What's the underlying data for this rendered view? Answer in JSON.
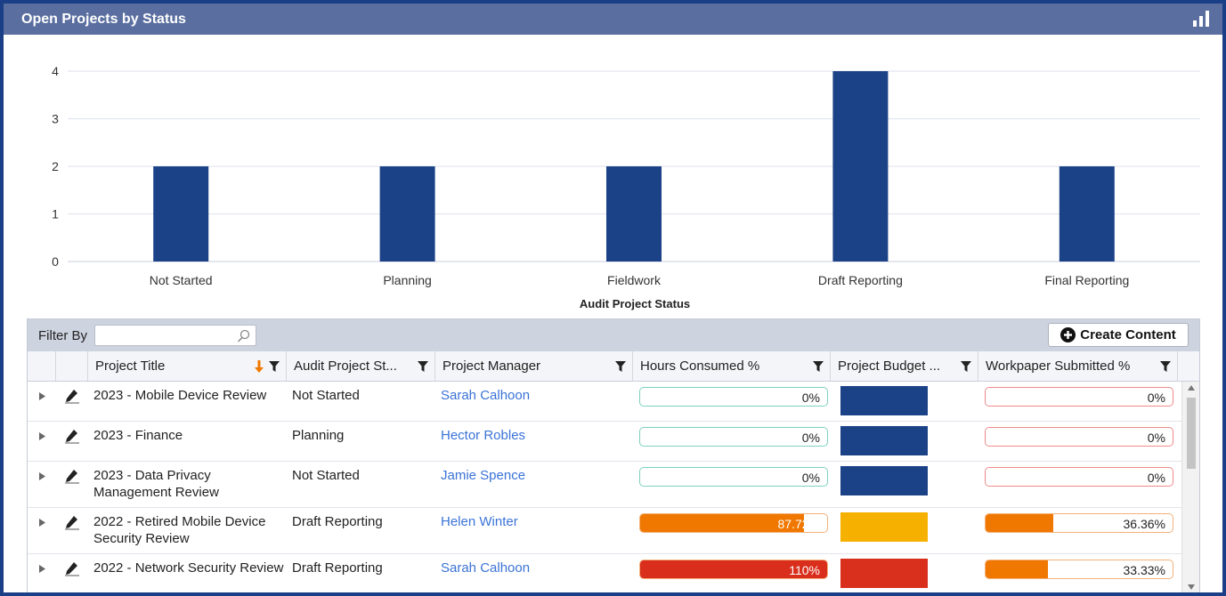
{
  "panel": {
    "title": "Open Projects by Status",
    "icon": "bar-chart-icon"
  },
  "chart_data": {
    "type": "bar",
    "categories": [
      "Not Started",
      "Planning",
      "Fieldwork",
      "Draft Reporting",
      "Final Reporting"
    ],
    "values": [
      2,
      2,
      2,
      4,
      2
    ],
    "title": "",
    "xlabel": "Audit Project Status",
    "ylabel": "",
    "ylim": [
      0,
      4
    ],
    "yticks": [
      0,
      1,
      2,
      3,
      4
    ],
    "bar_color": "#1b4287",
    "grid": true,
    "legend": "none"
  },
  "toolbar": {
    "filter_label": "Filter By",
    "filter_value": "",
    "filter_placeholder": "",
    "create_label": "Create Content"
  },
  "columns": [
    "Project Title",
    "Audit Project St...",
    "Project Manager",
    "Hours Consumed %",
    "Project Budget ...",
    "Workpaper Submitted %"
  ],
  "rows": [
    {
      "title": "2023 - Mobile Device Review",
      "status": "Not Started",
      "manager": "Sarah Calhoon",
      "hours_label": "0%",
      "hours_pct": 0,
      "hours_color": "#f07800",
      "budget_color": "#1b4287",
      "wp_label": "0%",
      "wp_pct": 0
    },
    {
      "title": "2023 - Finance",
      "status": "Planning",
      "manager": "Hector Robles",
      "hours_label": "0%",
      "hours_pct": 0,
      "hours_color": "#f07800",
      "budget_color": "#1b4287",
      "wp_label": "0%",
      "wp_pct": 0
    },
    {
      "title": "2023 - Data Privacy Management Review",
      "status": "Not Started",
      "manager": "Jamie Spence",
      "hours_label": "0%",
      "hours_pct": 0,
      "hours_color": "#f07800",
      "budget_color": "#1b4287",
      "wp_label": "0%",
      "wp_pct": 0
    },
    {
      "title": "2022 - Retired Mobile Device Security Review",
      "status": "Draft Reporting",
      "manager": "Helen Winter",
      "hours_label": "87.72%",
      "hours_pct": 87.72,
      "hours_color": "#f07800",
      "budget_color": "#f6b000",
      "wp_label": "36.36%",
      "wp_pct": 36.36
    },
    {
      "title": "2022 - Network Security Review",
      "status": "Draft Reporting",
      "manager": "Sarah Calhoon",
      "hours_label": "110%",
      "hours_pct": 100,
      "hours_color": "#d92e1c",
      "budget_color": "#d9301e",
      "wp_label": "33.33%",
      "wp_pct": 33.33
    }
  ],
  "colors": {
    "header_bg": "#5a6e9f",
    "frame": "#1b3f86",
    "link": "#3b73d6",
    "wp_fill": "#f07800",
    "zero_outline_hours": "#7fd0bf",
    "zero_outline_wp": "#f08a8a"
  }
}
